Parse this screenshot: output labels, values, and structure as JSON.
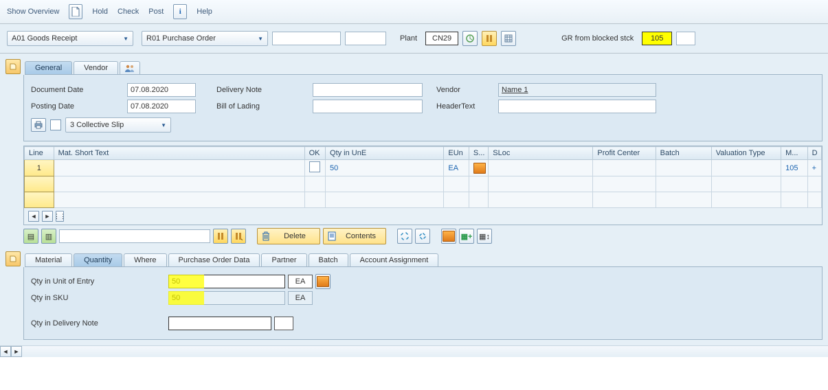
{
  "toolbar": {
    "overview": "Show Overview",
    "hold": "Hold",
    "check": "Check",
    "post": "Post",
    "help": "Help"
  },
  "filter": {
    "action_dd": "A01 Goods Receipt",
    "ref_dd": "R01 Purchase Order",
    "plant_label": "Plant",
    "plant_value": "CN29",
    "gr_label": "GR from blocked stck",
    "movement_type": "105"
  },
  "header_tabs": {
    "general": "General",
    "vendor": "Vendor"
  },
  "header": {
    "doc_date_lbl": "Document Date",
    "doc_date": "07.08.2020",
    "post_date_lbl": "Posting Date",
    "post_date": "07.08.2020",
    "deliv_note_lbl": "Delivery Note",
    "bol_lbl": "Bill of Lading",
    "vendor_lbl": "Vendor",
    "vendor_val": "Name 1",
    "headertext_lbl": "HeaderText",
    "slip_dd": "3 Collective Slip"
  },
  "grid": {
    "cols": {
      "line": "Line",
      "mat": "Mat. Short Text",
      "ok": "OK",
      "qty": "Qty in UnE",
      "eun": "EUn",
      "s": "S...",
      "sloc": "SLoc",
      "profit": "Profit Center",
      "batch": "Batch",
      "valtype": "Valuation Type",
      "m": "M...",
      "d": "D"
    },
    "row1": {
      "line": "1",
      "qty": "50",
      "eun": "EA",
      "m": "105",
      "d": "+"
    }
  },
  "actions": {
    "delete": "Delete",
    "contents": "Contents"
  },
  "detail_tabs": {
    "material": "Material",
    "quantity": "Quantity",
    "where": "Where",
    "po_data": "Purchase Order Data",
    "partner": "Partner",
    "batch": "Batch",
    "acct": "Account Assignment"
  },
  "qty": {
    "unit_entry_lbl": "Qty in Unit of Entry",
    "unit_entry_val": "50",
    "unit_entry_uom": "EA",
    "sku_lbl": "Qty in SKU",
    "sku_val": "50",
    "sku_uom": "EA",
    "deliv_lbl": "Qty in Delivery Note"
  }
}
